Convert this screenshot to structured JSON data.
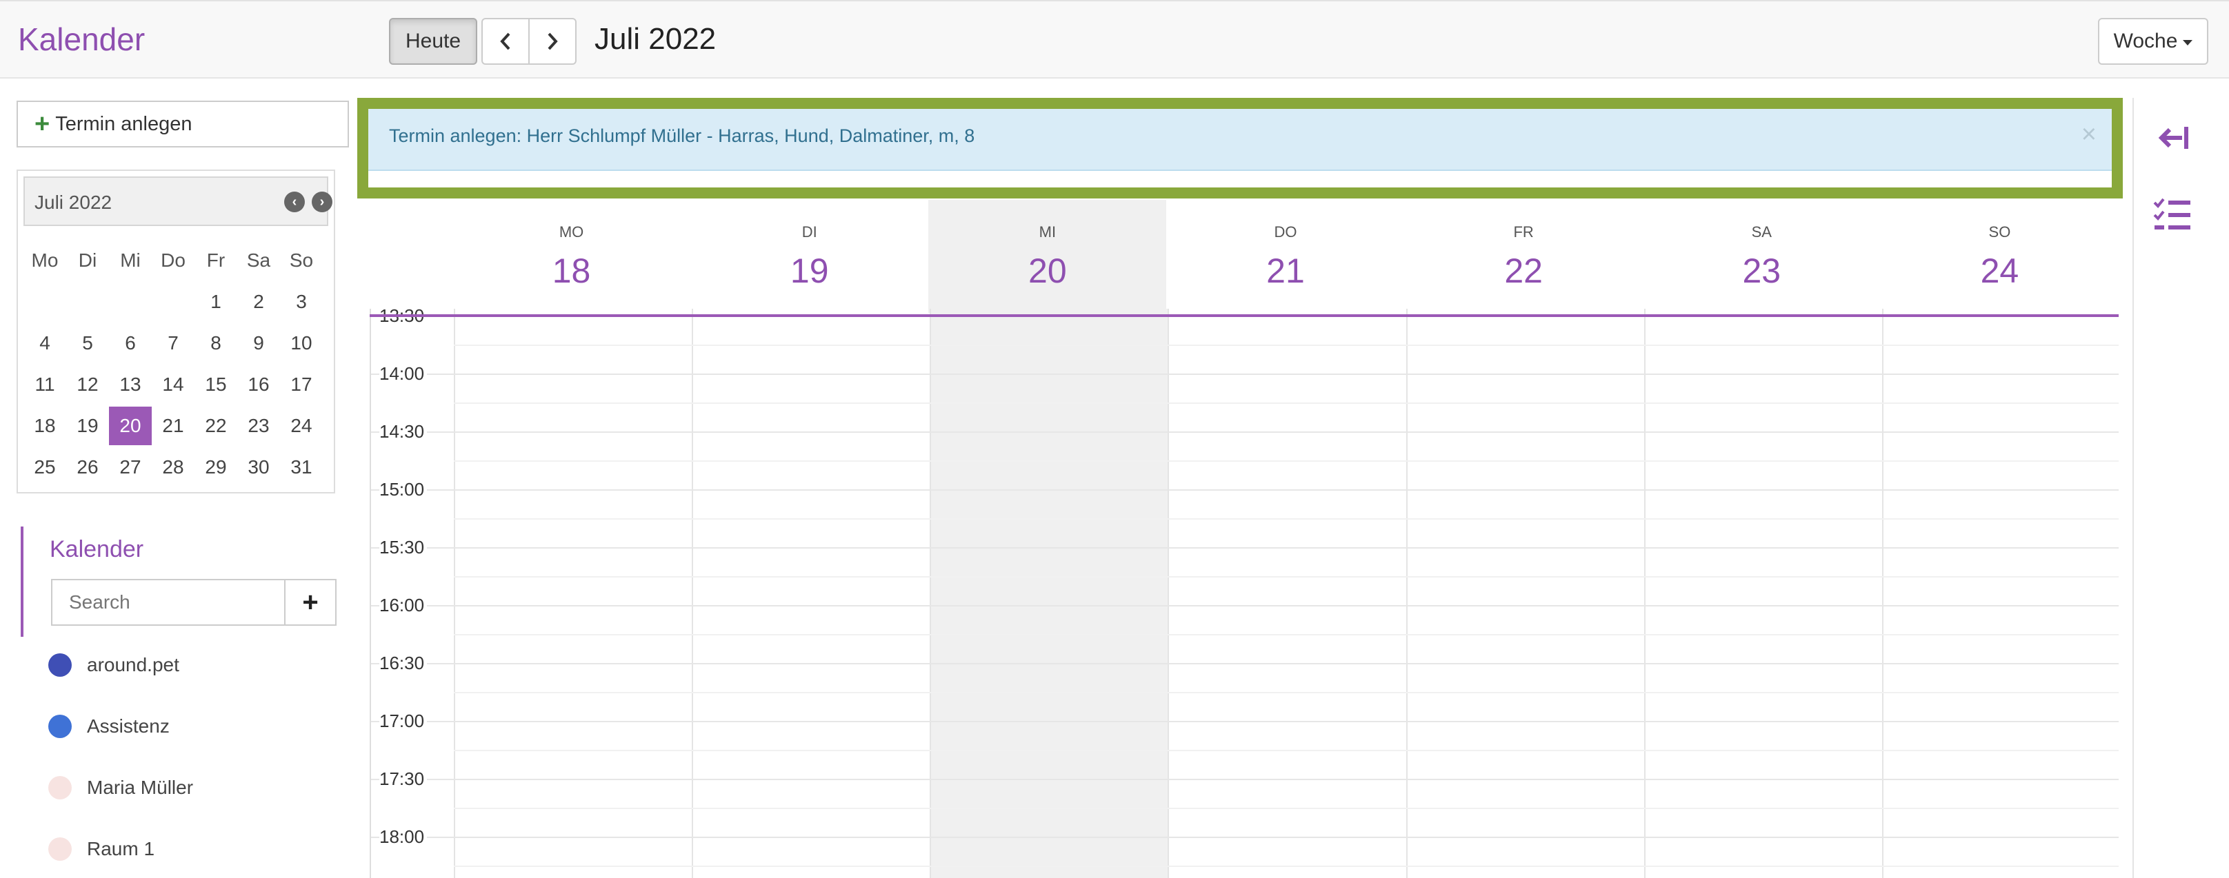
{
  "header": {
    "app_title": "Kalender",
    "today_label": "Heute",
    "prev_label": "‹",
    "next_label": "›",
    "period_title": "Juli 2022",
    "view_label": "Woche"
  },
  "sidebar": {
    "new_event_label": "Termin anlegen",
    "mini_calendar": {
      "month_label": "Juli 2022",
      "weekdays": [
        "Mo",
        "Di",
        "Mi",
        "Do",
        "Fr",
        "Sa",
        "So"
      ],
      "weeks": [
        [
          "",
          "",
          "",
          "",
          "1",
          "2",
          "3"
        ],
        [
          "4",
          "5",
          "6",
          "7",
          "8",
          "9",
          "10"
        ],
        [
          "11",
          "12",
          "13",
          "14",
          "15",
          "16",
          "17"
        ],
        [
          "18",
          "19",
          "20",
          "21",
          "22",
          "23",
          "24"
        ],
        [
          "25",
          "26",
          "27",
          "28",
          "29",
          "30",
          "31"
        ]
      ],
      "selected_day": "20"
    },
    "calendars_title": "Kalender",
    "search_placeholder": "Search",
    "add_label": "+",
    "calendars": [
      {
        "name": "around.pet",
        "color": "#3f4fb5"
      },
      {
        "name": "Assistenz",
        "color": "#3f72d6"
      },
      {
        "name": "Maria Müller",
        "color": "#f7e3e1"
      },
      {
        "name": "Raum 1",
        "color": "#f7e3e1"
      }
    ]
  },
  "notification": {
    "text": "Termin anlegen: Herr Schlumpf Müller - Harras, Hund, Dalmatiner, m, 8",
    "close_label": "×"
  },
  "week": {
    "days": [
      {
        "dow": "MO",
        "dom": "18",
        "today": false
      },
      {
        "dow": "DI",
        "dom": "19",
        "today": false
      },
      {
        "dow": "MI",
        "dom": "20",
        "today": true
      },
      {
        "dow": "DO",
        "dom": "21",
        "today": false
      },
      {
        "dow": "FR",
        "dom": "22",
        "today": false
      },
      {
        "dow": "SA",
        "dom": "23",
        "today": false
      },
      {
        "dow": "SO",
        "dom": "24",
        "today": false
      }
    ],
    "times": [
      "13:30",
      "14:00",
      "14:30",
      "15:00",
      "15:30",
      "16:00",
      "16:30",
      "17:00",
      "17:30",
      "18:00"
    ]
  },
  "colors": {
    "accent": "#9b59b6",
    "notification_border": "#89a83b",
    "notification_bg": "#d9ecf7"
  },
  "icons": {
    "collapse": "arrow-to-left-icon",
    "tasks": "task-list-icon"
  }
}
